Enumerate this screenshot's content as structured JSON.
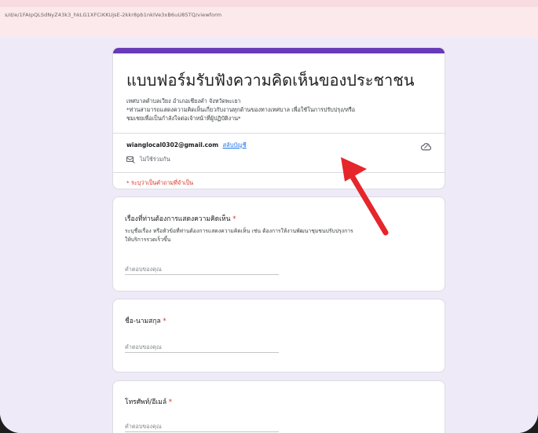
{
  "browser": {
    "url": "s/d/e/1FAIpQLSdNyZ43k3_hkLG1XFCiKKUjsE-2kkr8pb1nkIVe3xB6uU85TQ/viewform"
  },
  "form": {
    "title": "แบบฟอร์มรับฟังความคิดเห็นของประชาชน",
    "description_line1": "เทศบาลตำบลเวียง อำเภอเชียงคำ  จังหวัดพะเยา",
    "description_line2": "*ท่านสามารถแสดงความคิดเห็นเกี่ยวกับงานทุกด้านของทางเทศบาล เพื่อใช้ในการปรับปรุง/หรือ",
    "description_line3": "ชมเชยเพื่อเป็นกำลังใจต่อเจ้าหน้าที่ผู้ปฏิบัติงาน*",
    "account_email": "wianglocal0302@gmail.com",
    "switch_account": "สลับบัญชี",
    "not_shared": "ไม่ใช้ร่วมกัน",
    "required_note": "* ระบุว่าเป็นคำถามที่จำเป็น",
    "icons": {
      "cloud": "cloud-icon",
      "not_shared": "not-shared-icon"
    }
  },
  "questions": [
    {
      "title": "เรื่องที่ท่านต้องการแสดงความคิดเห็น",
      "required_mark": "*",
      "description_line1": "ระบุชื่อเรื่อง หรือหัวข้อที่ท่านต้องการแสดงความคิดเห็น เช่น ต้องการให้งานพัฒนาชุมชนปรับปรุงการ",
      "description_line2": "ให้บริการรวดเร็วขึ้น",
      "placeholder": "คำตอบของคุณ"
    },
    {
      "title": "ชื่อ-นามสกุล",
      "required_mark": "*",
      "placeholder": "คำตอบของคุณ"
    },
    {
      "title": "โทรศัพท์/อีเมล์",
      "required_mark": "*",
      "placeholder": "คำตอบของคุณ"
    }
  ],
  "annotation": {
    "arrow_color": "#e5262a"
  },
  "colors": {
    "accent": "#673ab7",
    "required": "#d93025",
    "link": "#1a73e8",
    "page_bg": "#efeaf7"
  }
}
